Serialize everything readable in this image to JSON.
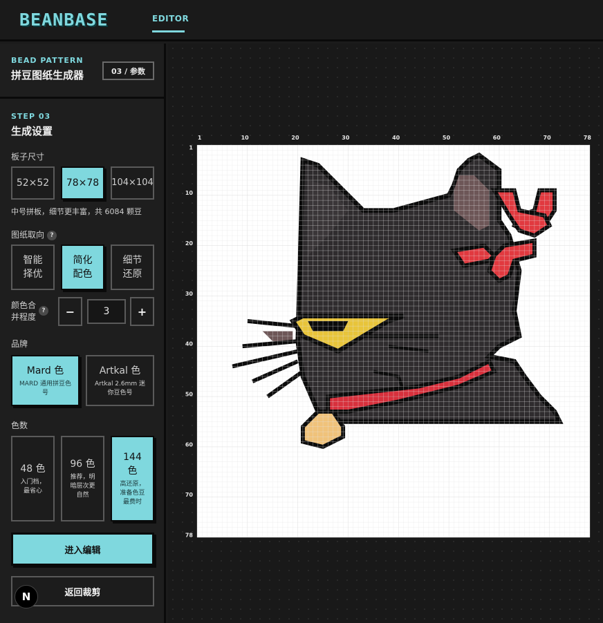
{
  "app": {
    "logo": "BEANBASE",
    "nav_editor": "EDITOR"
  },
  "panel": {
    "eyebrow": "BEAD PATTERN",
    "title": "拼豆图纸生成器",
    "step_pill": "03 / 参数"
  },
  "step": {
    "eyebrow": "STEP 03",
    "title": "生成设置"
  },
  "board_size": {
    "label": "板子尺寸",
    "options": [
      "52×52",
      "78×78",
      "104×104"
    ],
    "selected": "78×78",
    "hint": "中号拼板，细节更丰富，共 6084 颗豆"
  },
  "orientation": {
    "label": "图纸取向",
    "help_icon": "question-icon",
    "options": [
      "智能择优",
      "简化配色",
      "细节还原"
    ],
    "selected": "简化配色"
  },
  "merge": {
    "label": "颜色合并程度",
    "help_icon": "question-icon",
    "minus": "−",
    "plus": "+",
    "value": "3"
  },
  "brand": {
    "label": "品牌",
    "options": [
      {
        "name": "Mard 色",
        "desc": "MARD 通用拼豆色号"
      },
      {
        "name": "Artkal 色",
        "desc": "Artkal 2.6mm 迷你豆色号"
      }
    ],
    "selected": "Mard 色"
  },
  "colors": {
    "label": "色数",
    "options": [
      {
        "name": "48 色",
        "desc": "入门档，最省心"
      },
      {
        "name": "96 色",
        "desc": "推荐，明暗层次更自然"
      },
      {
        "name": "144 色",
        "desc": "高还原，准备色豆最费时"
      }
    ],
    "selected": "144 色"
  },
  "actions": {
    "enter_edit": "进入编辑",
    "back_crop": "返回裁剪",
    "badge": "N"
  },
  "pattern": {
    "grid_size": 78,
    "x_ticks": [
      "1",
      "10",
      "20",
      "30",
      "40",
      "50",
      "60",
      "70",
      "78"
    ],
    "y_ticks": [
      "1",
      "10",
      "20",
      "30",
      "40",
      "50",
      "60",
      "70",
      "78"
    ],
    "palette": {
      "background": "#ffffff",
      "outline": "#0b0b0b",
      "body": "#2f2c2e",
      "ear_inner": "#6d5657",
      "eye": "#e8c43a",
      "collar": "#d8303c",
      "bow": "#e1393f",
      "bell": "#f0c27a"
    }
  }
}
